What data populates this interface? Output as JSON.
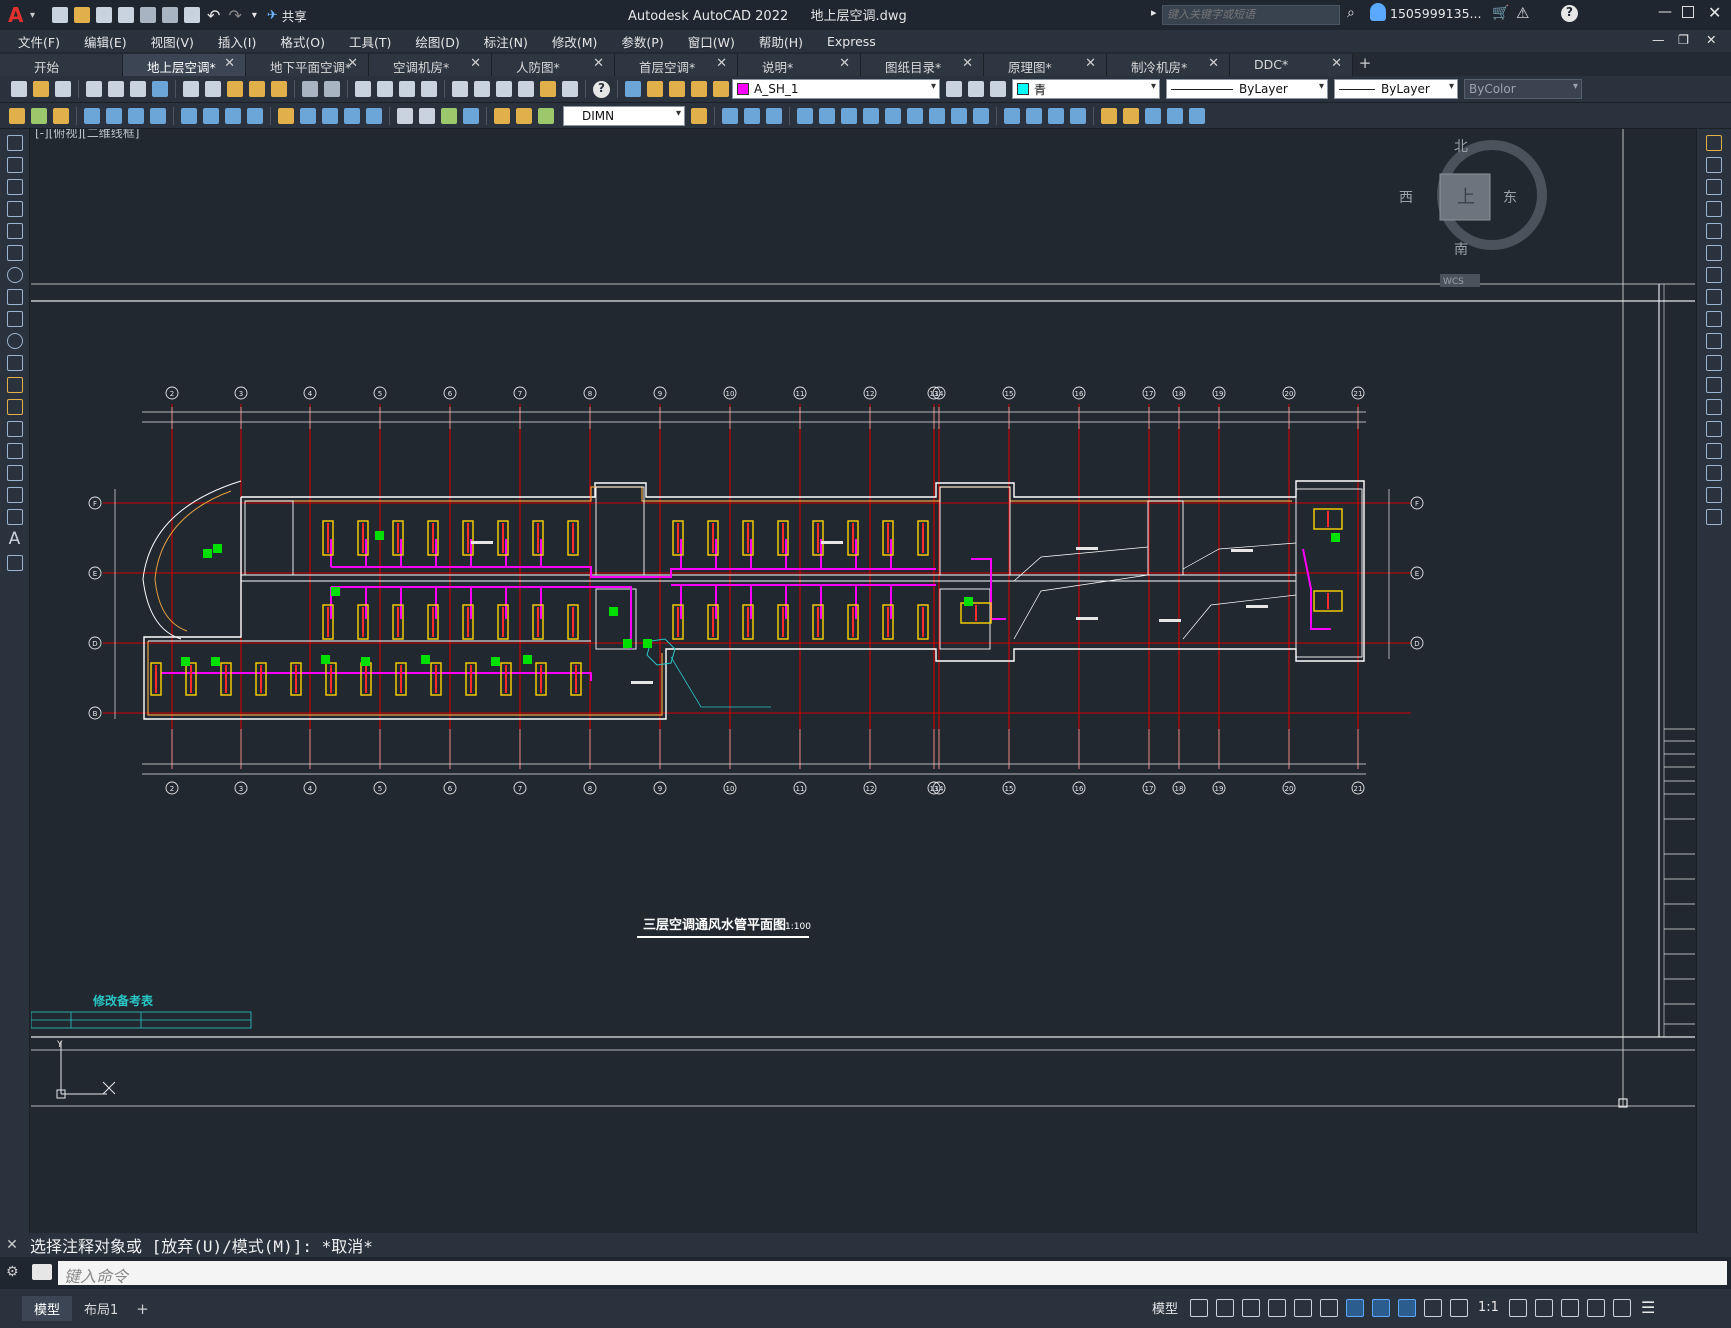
{
  "app": {
    "logo": "A",
    "title": "Autodesk AutoCAD 2022",
    "document": "地上层空调.dwg",
    "search_placeholder": "键入关键字或短语",
    "user": "1505999135...",
    "share_label": "共享"
  },
  "menu": [
    "文件(F)",
    "编辑(E)",
    "视图(V)",
    "插入(I)",
    "格式(O)",
    "工具(T)",
    "绘图(D)",
    "标注(N)",
    "修改(M)",
    "参数(P)",
    "窗口(W)",
    "帮助(H)",
    "Express"
  ],
  "tabs": [
    {
      "label": "开始",
      "closable": false,
      "active": false
    },
    {
      "label": "地上层空调*",
      "closable": true,
      "active": true
    },
    {
      "label": "地下平面空调*",
      "closable": true,
      "active": false
    },
    {
      "label": "空调机房*",
      "closable": true,
      "active": false
    },
    {
      "label": "人防图*",
      "closable": true,
      "active": false
    },
    {
      "label": "首层空调*",
      "closable": true,
      "active": false
    },
    {
      "label": "说明*",
      "closable": true,
      "active": false
    },
    {
      "label": "图纸目录*",
      "closable": true,
      "active": false
    },
    {
      "label": "原理图*",
      "closable": true,
      "active": false
    },
    {
      "label": "制冷机房*",
      "closable": true,
      "active": false
    },
    {
      "label": "DDC*",
      "closable": true,
      "active": false
    }
  ],
  "toolbar": {
    "layer": {
      "name": "A_SH_1",
      "color": "#ff00ff"
    },
    "color": {
      "name": "青",
      "color": "#00ffff"
    },
    "linetype": "ByLayer",
    "lineweight": "ByLayer",
    "plotstyle": "ByColor",
    "dimstyle": "DIMN"
  },
  "viewport": {
    "label": "[-][俯视][二维线框]",
    "viewcube": {
      "north": "北",
      "south": "南",
      "east": "东",
      "west": "西",
      "face": "上",
      "wcs": "WCS"
    }
  },
  "drawing": {
    "title": "三层空调通风水管平面图",
    "scale": "1:100",
    "revision_title": "修改备考表",
    "axes_top": [
      "2",
      "3",
      "4",
      "5",
      "6",
      "7",
      "8",
      "9",
      "10",
      "11",
      "12",
      "13",
      "14",
      "15",
      "16",
      "17",
      "18",
      "19",
      "20",
      "21"
    ],
    "axes_side": [
      "F",
      "E",
      "D",
      "B"
    ],
    "accent": {
      "axis": "#d40000",
      "wall": "#ffffff",
      "duct": "#ff00ff",
      "unit": "#ffd400",
      "fan": "#ff2a2a",
      "equip": "#00e000",
      "cyan": "#29c6c6",
      "orange": "#e8a040"
    }
  },
  "command": {
    "history": "选择注释对象或 [放弃(U)/模式(M)]: *取消*",
    "placeholder": "键入命令"
  },
  "status": {
    "tabs": [
      "模型",
      "布局1"
    ],
    "model_label": "模型",
    "scale": "1:1"
  }
}
